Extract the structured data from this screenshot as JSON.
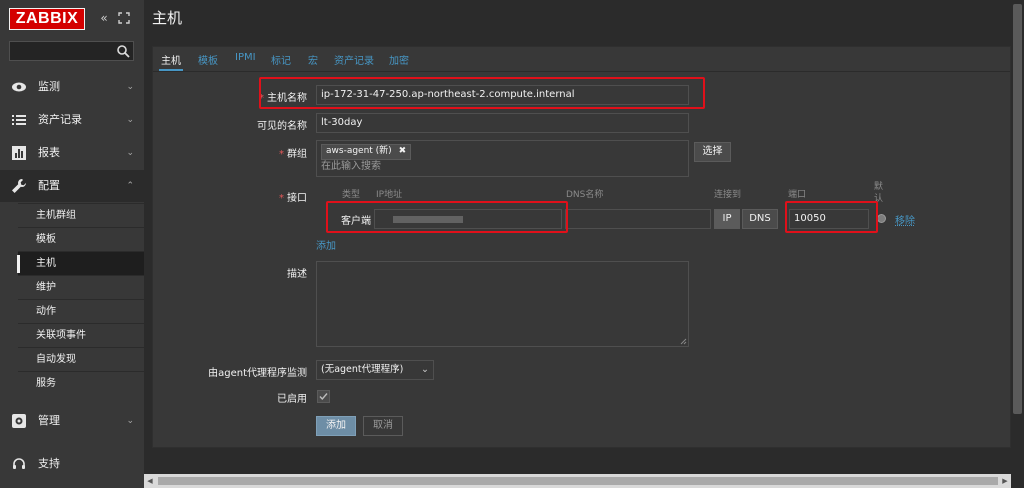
{
  "brand": {
    "logo": "ZABBIX"
  },
  "sidebar": {
    "search_placeholder": "",
    "nav": [
      {
        "label": "监测",
        "icon": "eye-icon"
      },
      {
        "label": "资产记录",
        "icon": "list-icon"
      },
      {
        "label": "报表",
        "icon": "chart-icon"
      },
      {
        "label": "配置",
        "icon": "wrench-icon"
      },
      {
        "label": "管理",
        "icon": "gear-icon"
      },
      {
        "label": "支持",
        "icon": "headset-icon"
      }
    ],
    "config_items": [
      "主机群组",
      "模板",
      "主机",
      "维护",
      "动作",
      "关联项事件",
      "自动发现",
      "服务"
    ],
    "selected_item": "主机"
  },
  "page": {
    "title": "主机"
  },
  "tabs": [
    "主机",
    "模板",
    "IPMI",
    "标记",
    "宏",
    "资产记录",
    "加密"
  ],
  "form": {
    "host_name_label": "主机名称",
    "host_name_value": "ip-172-31-47-250.ap-northeast-2.compute.internal",
    "visible_name_label": "可见的名称",
    "visible_name_value": "lt-30day",
    "groups_label": "群组",
    "group_tag": "aws-agent (新)",
    "group_search_placeholder": "在此输入搜索",
    "select_button": "选择",
    "interfaces_label": "接口",
    "iface_headers": {
      "type": "类型",
      "ip": "IP地址",
      "dns": "DNS名称",
      "connect": "连接到",
      "port": "端口",
      "default": "默认"
    },
    "iface_type": "客户端",
    "ip_button": "IP",
    "dns_button": "DNS",
    "port_value": "10050",
    "remove_link": "移除",
    "add_link": "添加",
    "description_label": "描述",
    "proxy_label": "由agent代理程序监测",
    "proxy_value": "(无agent代理程序)",
    "enabled_label": "已启用",
    "add_button": "添加",
    "cancel_button": "取消"
  },
  "colors": {
    "accent": "#4796c4",
    "logo": "#d40000",
    "highlight": "#e0101a"
  }
}
